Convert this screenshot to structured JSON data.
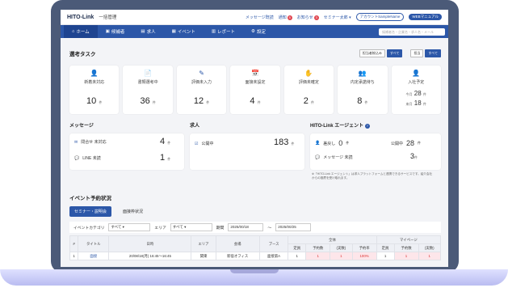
{
  "header": {
    "logo": "HITO-Link",
    "app_name": "一括管理",
    "links": [
      {
        "label": "メッセージ既読",
        "badge": ""
      },
      {
        "label": "通知",
        "badge": "5"
      },
      {
        "label": "お知らせ",
        "badge": "3"
      },
      {
        "label": "セミナー太郎",
        "badge": ""
      }
    ],
    "pill_account": "アカウントSampleName",
    "pill_manual": "WEBマニュアル"
  },
  "nav": {
    "items": [
      {
        "icon": "⌂",
        "label": "ホーム"
      },
      {
        "icon": "▣",
        "label": "候補者"
      },
      {
        "icon": "▤",
        "label": "求人"
      },
      {
        "icon": "▦",
        "label": "イベント"
      },
      {
        "icon": "▥",
        "label": "レポート"
      },
      {
        "icon": "⚙",
        "label": "設定"
      }
    ],
    "search_placeholder": "候補者名・企業名・求人名・メール"
  },
  "tasks": {
    "title": "選考タスク",
    "toggle1": [
      "担当者絞込み",
      "すべて"
    ],
    "toggle2": [
      "担当",
      "すべて"
    ],
    "cards": [
      {
        "icon": "👤",
        "label": "新着未対応",
        "value": "10",
        "unit": "件"
      },
      {
        "icon": "📄",
        "label": "書類選考中",
        "value": "36",
        "unit": "件"
      },
      {
        "icon": "✎",
        "label": "評価未入力",
        "value": "12",
        "unit": "件"
      },
      {
        "icon": "📅",
        "label": "面接未設定",
        "value": "4",
        "unit": "件"
      },
      {
        "icon": "✋",
        "label": "評価未確定",
        "value": "2",
        "unit": "件"
      },
      {
        "icon": "👥",
        "label": "内定承諾待ち",
        "value": "8",
        "unit": "件"
      },
      {
        "icon": "👤",
        "label": "入社予定",
        "today_label": "今月",
        "today_value": "28",
        "next_label": "来月",
        "next_value": "18",
        "unit": "件"
      }
    ]
  },
  "messages": {
    "title": "メッセージ",
    "rows": [
      {
        "icon": "✉",
        "label": "問合せ 未対応",
        "value": "4",
        "unit": "件"
      },
      {
        "icon": "💬",
        "label": "LINE 未読",
        "value": "1",
        "unit": "件"
      }
    ]
  },
  "jobs": {
    "title": "求人",
    "label": "公開中",
    "value": "183",
    "unit": "件"
  },
  "agent": {
    "title": "HITO-Link エージェント",
    "rows": [
      {
        "label": "差戻し",
        "value": "0",
        "unit": "件"
      },
      {
        "label": "公開中",
        "value": "28",
        "unit": "件"
      },
      {
        "label": "メッセージ 未読",
        "value": "3",
        "unit": "件"
      }
    ],
    "note": "※「HITO-Link エージェント」は求人プラットフォームと連携できるサービスです。紹介会社からの推薦を受け取れます。"
  },
  "events": {
    "title": "イベント予約状況",
    "tabs": [
      "セミナー・説明会",
      "面接枠状況"
    ],
    "filters": {
      "category_label": "イベントカテゴリ",
      "category_value": "すべて",
      "area_label": "エリア",
      "area_value": "すべて",
      "period_label": "期間",
      "date_from": "2025/00/18",
      "date_sep": "〜",
      "date_to": "2025/00/25"
    },
    "columns": [
      "#",
      "タイトル",
      "日時",
      "エリア",
      "会場",
      "ブース",
      "定員",
      "予約数",
      "(実数)",
      "予約率",
      "定員",
      "予約数",
      "(実数)"
    ],
    "group_headers": {
      "all": "全体",
      "mypage": "マイページ"
    },
    "rows": [
      [
        "1",
        "面接",
        "20/08/18(月) 16:45〜16:45",
        "関東",
        "新宿オフィス",
        "面接第A",
        "1",
        "1",
        "1",
        "100%",
        "1",
        "1",
        "1"
      ]
    ]
  }
}
